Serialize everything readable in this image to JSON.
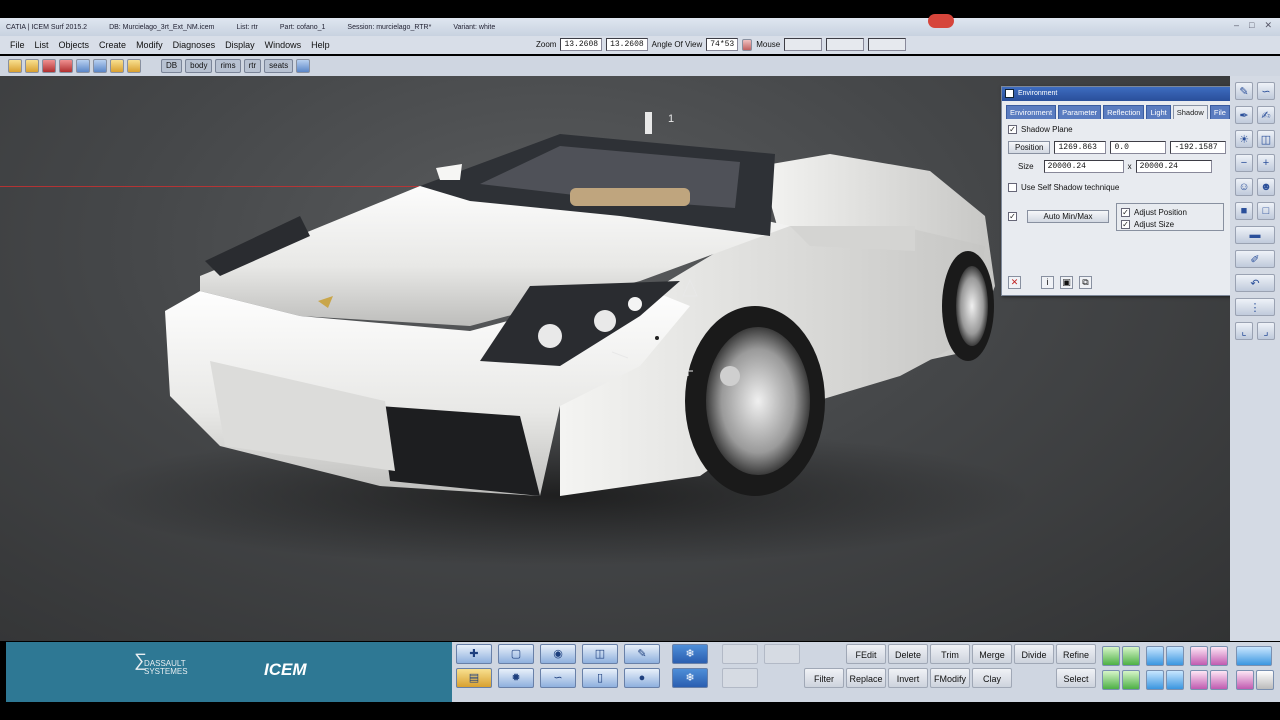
{
  "titlebar": {
    "app": "CATIA | ICEM Surf 2015.2",
    "db": "DB: Murcielago_3rt_Ext_NM.icem",
    "list": "List: rtr",
    "part": "Part: cofano_1",
    "session": "Session: murcielago_RTR*",
    "variant": "Variant: white"
  },
  "menu": [
    "File",
    "List",
    "Objects",
    "Create",
    "Modify",
    "Diagnoses",
    "Display",
    "Windows",
    "Help"
  ],
  "zoombar": {
    "zoom_label": "Zoom",
    "zoom_value_1": "13.2608",
    "zoom_value_2": "13.2608",
    "angle_label": "Angle Of View",
    "angle_value": "74*53",
    "mouse_label": "Mouse"
  },
  "toolbar": {
    "db_label": "DB",
    "list_buttons": [
      "body",
      "rims",
      "rtr",
      "seats"
    ]
  },
  "viewport": {
    "marker_label": "1"
  },
  "environment_dialog": {
    "title": "Environment",
    "tabs": [
      "Environment",
      "Parameter",
      "Reflection",
      "Light",
      "Shadow",
      "File"
    ],
    "active_tab": "Shadow",
    "shadow_plane_label": "Shadow Plane",
    "position_label": "Position",
    "position_x": "1269.863",
    "position_y": "0.0",
    "position_z": "-192.1587",
    "size_label": "Size",
    "size_w": "20000.24",
    "size_sep": "x",
    "size_h": "20000.24",
    "self_shadow_label": "Use Self Shadow technique",
    "auto_minmax_label": "Auto Min/Max",
    "adjust_position_label": "Adjust Position",
    "adjust_size_label": "Adjust Size"
  },
  "branding": {
    "ds_line1": "DASSAULT",
    "ds_line2": "SYSTEMES",
    "icem": "ICEM"
  },
  "bottom_buttons": {
    "row1": [
      "FEdit",
      "Delete",
      "Trim",
      "Merge",
      "Divide",
      "Refine"
    ],
    "row2": [
      "Filter",
      "Replace",
      "Invert",
      "FModify",
      "Clay",
      "Select"
    ]
  },
  "colors": {
    "dialog_title": "#2a4f9a",
    "brand_panel": "#2e7894",
    "viewport_bg": "#454749",
    "car_body": "#f2f2f0"
  }
}
